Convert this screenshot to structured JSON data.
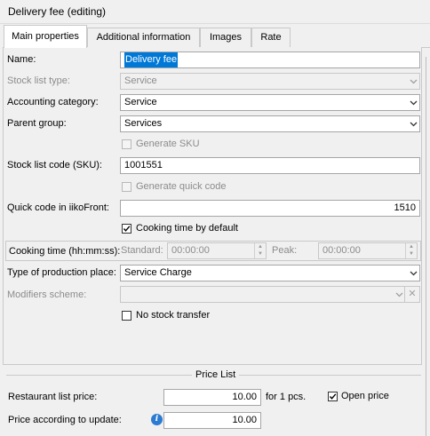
{
  "window": {
    "title": "Delivery fee (editing)"
  },
  "tabs": [
    {
      "label": "Main properties"
    },
    {
      "label": "Additional information"
    },
    {
      "label": "Images"
    },
    {
      "label": "Rate"
    }
  ],
  "form": {
    "name": {
      "label": "Name:",
      "value": "Delivery fee"
    },
    "stock_list_type": {
      "label": "Stock list type:",
      "value": "Service"
    },
    "accounting_category": {
      "label": "Accounting category:",
      "value": "Service"
    },
    "parent_group": {
      "label": "Parent group:",
      "value": "Services"
    },
    "generate_sku": {
      "label": "Generate SKU",
      "checked": false
    },
    "sku": {
      "label": "Stock list code (SKU):",
      "value": "1001551"
    },
    "generate_quick_code": {
      "label": "Generate quick code",
      "checked": false
    },
    "quick_code": {
      "label": "Quick code in iikoFront:",
      "value": "1510"
    },
    "cooking_time_default": {
      "label": "Cooking time by default",
      "checked": true
    },
    "cooking_time": {
      "label": "Cooking time (hh:mm:ss):",
      "standard_label": "Standard:",
      "standard_value": "00:00:00",
      "peak_label": "Peak:",
      "peak_value": "00:00:00"
    },
    "production_place": {
      "label": "Type of production place:",
      "value": "Service Charge"
    },
    "modifiers_scheme": {
      "label": "Modifiers scheme:",
      "value": ""
    },
    "no_stock_transfer": {
      "label": "No stock transfer",
      "checked": false
    }
  },
  "price_list": {
    "title": "Price List",
    "restaurant_price_label": "Restaurant list price:",
    "restaurant_price_value": "10.00",
    "per_unit": "for 1 pcs.",
    "open_price_label": "Open price",
    "open_price_checked": true,
    "update_price_label": "Price according to update:",
    "update_price_value": "10.00"
  },
  "icons": {
    "info": "info-icon",
    "dropdown": "chevron-down-icon",
    "check": "check-icon"
  },
  "colors": {
    "selection": "#0078d7",
    "info": "#2a7bd1"
  }
}
